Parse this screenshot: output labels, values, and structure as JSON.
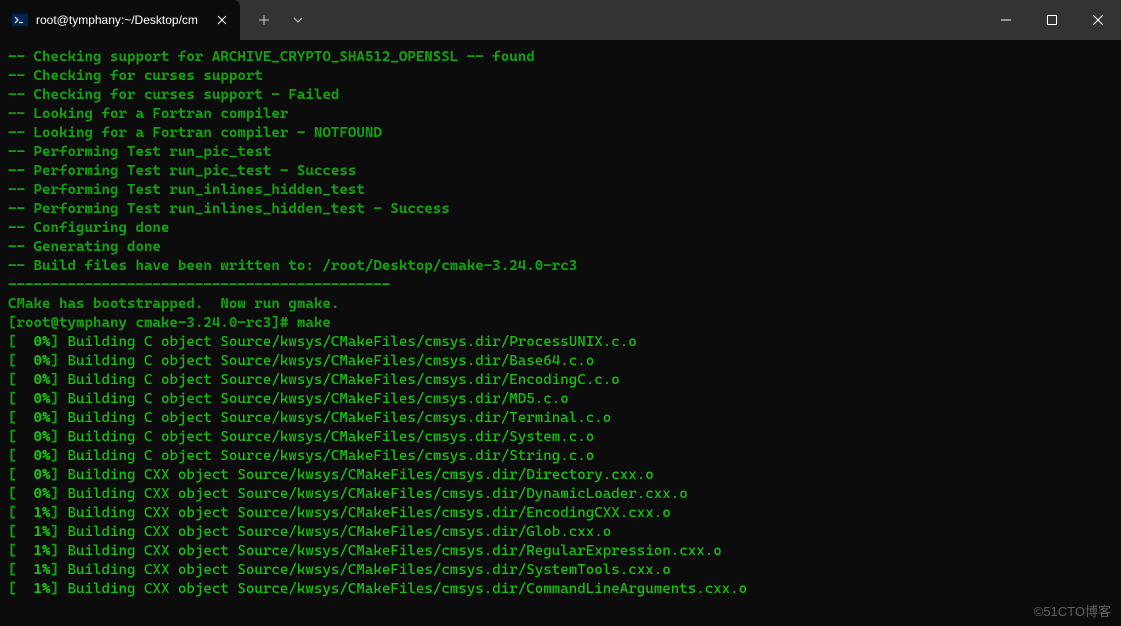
{
  "titlebar": {
    "tab_title": "root@tymphany:~/Desktop/cm",
    "close_label": "✕",
    "new_tab_label": "+",
    "dropdown_label": "⌄",
    "min_label": "—",
    "max_label": "▢",
    "win_close_label": "✕"
  },
  "terminal": {
    "lines": [
      {
        "prefix": "-- ",
        "text": "Checking support for ARCHIVE_CRYPTO_SHA512_OPENSSL -- found",
        "class": "green bold"
      },
      {
        "prefix": "-- ",
        "text": "Checking for curses support",
        "class": "green bold"
      },
      {
        "prefix": "-- ",
        "text": "Checking for curses support - Failed",
        "class": "green bold"
      },
      {
        "prefix": "-- ",
        "text": "Looking for a Fortran compiler",
        "class": "green bold"
      },
      {
        "prefix": "-- ",
        "text": "Looking for a Fortran compiler - NOTFOUND",
        "class": "green bold"
      },
      {
        "prefix": "-- ",
        "text": "Performing Test run_pic_test",
        "class": "green bold"
      },
      {
        "prefix": "-- ",
        "text": "Performing Test run_pic_test - Success",
        "class": "green bold"
      },
      {
        "prefix": "-- ",
        "text": "Performing Test run_inlines_hidden_test",
        "class": "green bold"
      },
      {
        "prefix": "-- ",
        "text": "Performing Test run_inlines_hidden_test - Success",
        "class": "green bold"
      },
      {
        "prefix": "-- ",
        "text": "Configuring done",
        "class": "green bold"
      },
      {
        "prefix": "-- ",
        "text": "Generating done",
        "class": "green bold"
      },
      {
        "prefix": "-- ",
        "text": "Build files have been written to: /root/Desktop/cmake-3.24.0-rc3",
        "class": "green bold"
      },
      {
        "prefix": "",
        "text": "---------------------------------------------",
        "class": "green bold"
      },
      {
        "prefix": "",
        "text": "CMake has bootstrapped.  Now run gmake.",
        "class": "green bold"
      }
    ],
    "prompt": {
      "prompt_text": "[root@tymphany cmake-3.24.0-rc3]# ",
      "command": "make"
    },
    "build_lines": [
      {
        "pct": "  0%",
        "text": "Building C object Source/kwsys/CMakeFiles/cmsys.dir/ProcessUNIX.c.o"
      },
      {
        "pct": "  0%",
        "text": "Building C object Source/kwsys/CMakeFiles/cmsys.dir/Base64.c.o"
      },
      {
        "pct": "  0%",
        "text": "Building C object Source/kwsys/CMakeFiles/cmsys.dir/EncodingC.c.o"
      },
      {
        "pct": "  0%",
        "text": "Building C object Source/kwsys/CMakeFiles/cmsys.dir/MD5.c.o"
      },
      {
        "pct": "  0%",
        "text": "Building C object Source/kwsys/CMakeFiles/cmsys.dir/Terminal.c.o"
      },
      {
        "pct": "  0%",
        "text": "Building C object Source/kwsys/CMakeFiles/cmsys.dir/System.c.o"
      },
      {
        "pct": "  0%",
        "text": "Building C object Source/kwsys/CMakeFiles/cmsys.dir/String.c.o"
      },
      {
        "pct": "  0%",
        "text": "Building CXX object Source/kwsys/CMakeFiles/cmsys.dir/Directory.cxx.o"
      },
      {
        "pct": "  0%",
        "text": "Building CXX object Source/kwsys/CMakeFiles/cmsys.dir/DynamicLoader.cxx.o"
      },
      {
        "pct": "  1%",
        "text": "Building CXX object Source/kwsys/CMakeFiles/cmsys.dir/EncodingCXX.cxx.o"
      },
      {
        "pct": "  1%",
        "text": "Building CXX object Source/kwsys/CMakeFiles/cmsys.dir/Glob.cxx.o"
      },
      {
        "pct": "  1%",
        "text": "Building CXX object Source/kwsys/CMakeFiles/cmsys.dir/RegularExpression.cxx.o"
      },
      {
        "pct": "  1%",
        "text": "Building CXX object Source/kwsys/CMakeFiles/cmsys.dir/SystemTools.cxx.o"
      },
      {
        "pct": "  1%",
        "text": "Building CXX object Source/kwsys/CMakeFiles/cmsys.dir/CommandLineArguments.cxx.o"
      }
    ]
  },
  "watermark": "©51CTO博客"
}
